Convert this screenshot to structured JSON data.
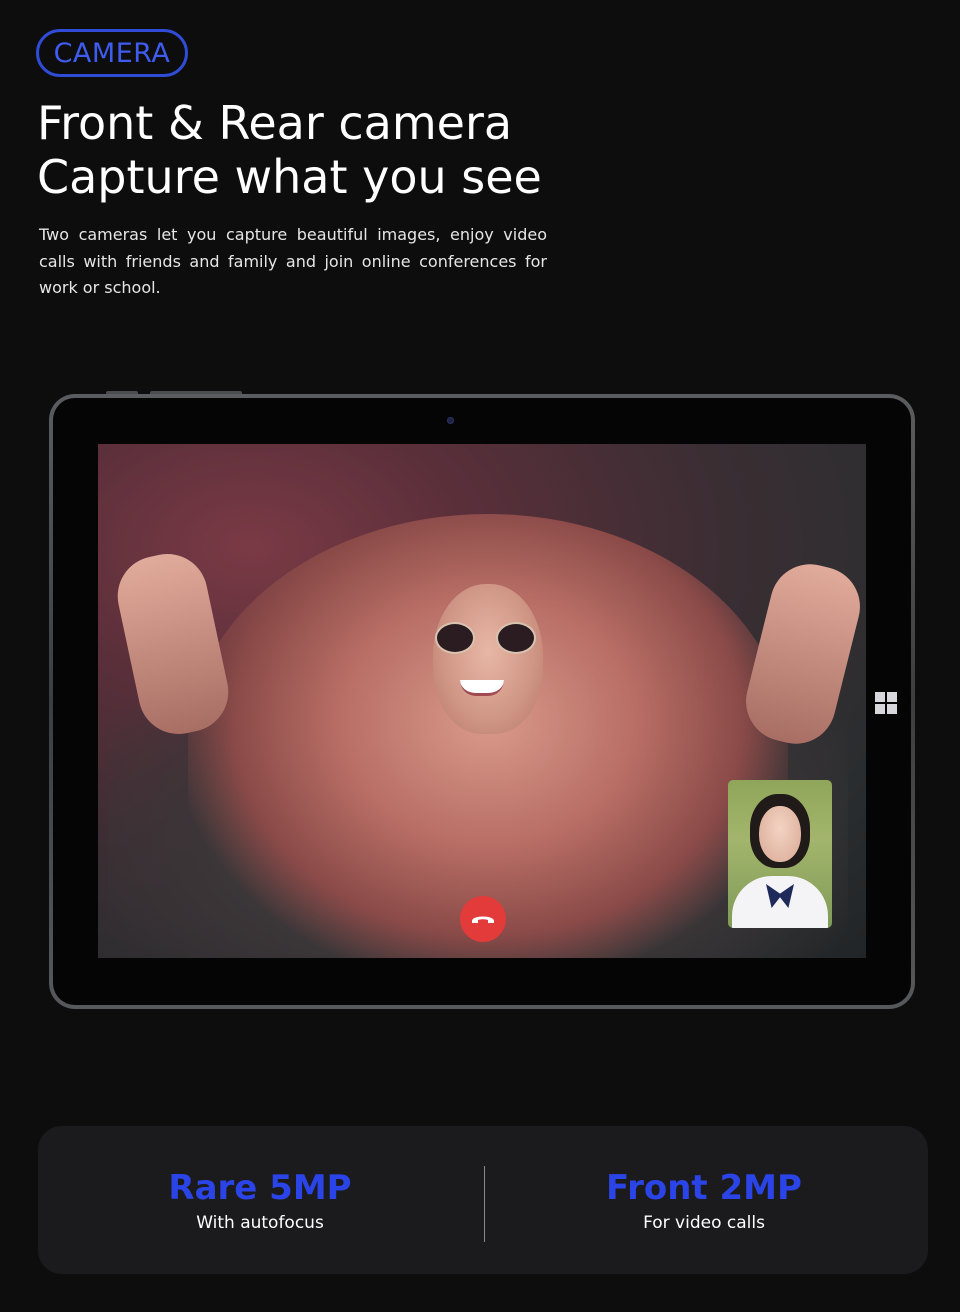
{
  "badge": {
    "label": "CAMERA"
  },
  "headline": {
    "line1": "Front & Rear camera",
    "line2": "Capture what you see"
  },
  "description": "Two cameras let you capture beautiful images, enjoy video calls with friends and family and join online conferences for work or school.",
  "specs": [
    {
      "title": "Rare 5MP",
      "subtitle": "With autofocus"
    },
    {
      "title": "Front 2MP",
      "subtitle": "For video calls"
    }
  ],
  "colors": {
    "accent": "#2b44e8",
    "background": "#0d0d0e",
    "card": "#1b1b1d",
    "end_call": "#e33a3a"
  },
  "icons": {
    "end_call": "phone-hangup-icon",
    "os_logo": "windows-logo-icon",
    "front_camera": "camera-lens-icon"
  }
}
